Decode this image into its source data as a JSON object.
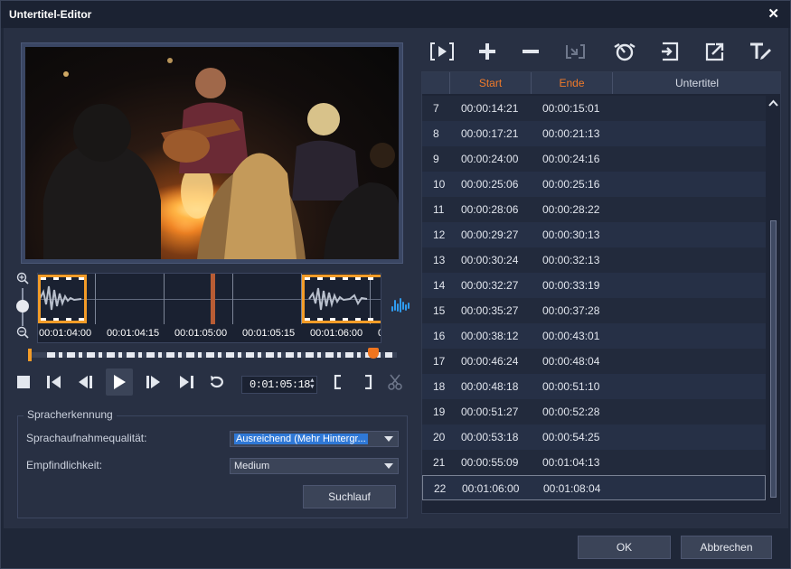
{
  "window": {
    "title": "Untertitel-Editor",
    "close_icon": "close-icon"
  },
  "timeline": {
    "labels": [
      "00:01:04:00",
      "00:01:04:15",
      "00:01:05:00",
      "00:01:05:15",
      "00:01:06:00",
      "0"
    ]
  },
  "transport": {
    "timecode": "0:01:05:18"
  },
  "speech": {
    "legend": "Spracherkennung",
    "quality_label": "Sprachaufnahmequalität:",
    "quality_value": "Ausreichend (Mehr Hintergr...",
    "sensitivity_label": "Empfindlichkeit:",
    "sensitivity_value": "Medium",
    "scan_button": "Suchlauf"
  },
  "table": {
    "headers": {
      "index": "",
      "start": "Start",
      "end": "Ende",
      "subtitle": "Untertitel"
    },
    "rows": [
      {
        "idx": "7",
        "start": "00:00:14:21",
        "end": "00:00:15:01",
        "text": ""
      },
      {
        "idx": "8",
        "start": "00:00:17:21",
        "end": "00:00:21:13",
        "text": ""
      },
      {
        "idx": "9",
        "start": "00:00:24:00",
        "end": "00:00:24:16",
        "text": ""
      },
      {
        "idx": "10",
        "start": "00:00:25:06",
        "end": "00:00:25:16",
        "text": ""
      },
      {
        "idx": "11",
        "start": "00:00:28:06",
        "end": "00:00:28:22",
        "text": ""
      },
      {
        "idx": "12",
        "start": "00:00:29:27",
        "end": "00:00:30:13",
        "text": ""
      },
      {
        "idx": "13",
        "start": "00:00:30:24",
        "end": "00:00:32:13",
        "text": ""
      },
      {
        "idx": "14",
        "start": "00:00:32:27",
        "end": "00:00:33:19",
        "text": ""
      },
      {
        "idx": "15",
        "start": "00:00:35:27",
        "end": "00:00:37:28",
        "text": ""
      },
      {
        "idx": "16",
        "start": "00:00:38:12",
        "end": "00:00:43:01",
        "text": ""
      },
      {
        "idx": "17",
        "start": "00:00:46:24",
        "end": "00:00:48:04",
        "text": ""
      },
      {
        "idx": "18",
        "start": "00:00:48:18",
        "end": "00:00:51:10",
        "text": ""
      },
      {
        "idx": "19",
        "start": "00:00:51:27",
        "end": "00:00:52:28",
        "text": ""
      },
      {
        "idx": "20",
        "start": "00:00:53:18",
        "end": "00:00:54:25",
        "text": ""
      },
      {
        "idx": "21",
        "start": "00:00:55:09",
        "end": "00:01:04:13",
        "text": ""
      },
      {
        "idx": "22",
        "start": "00:01:06:00",
        "end": "00:01:08:04",
        "text": ""
      }
    ],
    "selected_index": 15
  },
  "buttons": {
    "ok": "OK",
    "cancel": "Abbrechen"
  },
  "colors": {
    "accent_orange": "#f39c28",
    "header_orange": "#f07a2a",
    "highlight_blue": "#2f78d6",
    "audio_icon_blue": "#2f9bef"
  }
}
